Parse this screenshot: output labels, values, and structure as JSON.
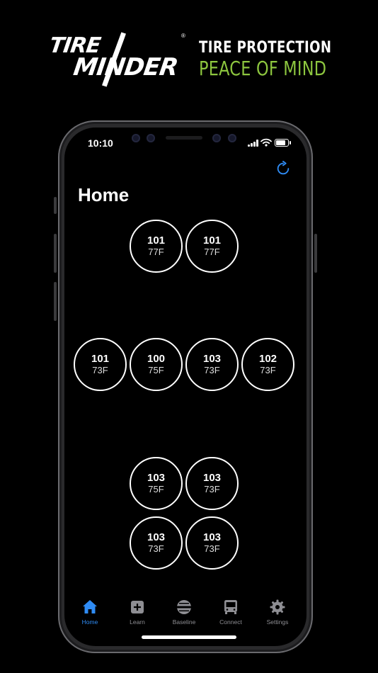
{
  "brand": {
    "logo_top": "TIRE",
    "logo_bottom": "MINDER",
    "logo_mark": "®",
    "tagline_1": "TIRE PROTECTION",
    "tagline_2": "PEACE OF MIND",
    "tagline_2_color": "#8dc63f"
  },
  "status_bar": {
    "time": "10:10"
  },
  "page": {
    "title": "Home"
  },
  "tires": {
    "front": [
      {
        "pressure": "101",
        "temp": "77F"
      },
      {
        "pressure": "101",
        "temp": "77F"
      }
    ],
    "middle": [
      {
        "pressure": "101",
        "temp": "73F"
      },
      {
        "pressure": "100",
        "temp": "75F"
      },
      {
        "pressure": "103",
        "temp": "73F"
      },
      {
        "pressure": "102",
        "temp": "73F"
      }
    ],
    "rear_1": [
      {
        "pressure": "103",
        "temp": "75F"
      },
      {
        "pressure": "103",
        "temp": "73F"
      }
    ],
    "rear_2": [
      {
        "pressure": "103",
        "temp": "73F"
      },
      {
        "pressure": "103",
        "temp": "73F"
      }
    ]
  },
  "tabs": [
    {
      "label": "Home",
      "icon": "house-icon",
      "active": true
    },
    {
      "label": "Learn",
      "icon": "plus-square-icon",
      "active": false
    },
    {
      "label": "Baseline",
      "icon": "tire-icon",
      "active": false
    },
    {
      "label": "Connect",
      "icon": "bus-icon",
      "active": false
    },
    {
      "label": "Settings",
      "icon": "gear-icon",
      "active": false
    }
  ],
  "colors": {
    "accent": "#2f8cf5",
    "inactive": "#8e8e93"
  }
}
